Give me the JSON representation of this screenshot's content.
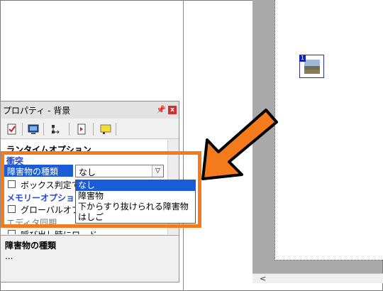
{
  "panel": {
    "title": "プロパティ - 背景",
    "pin_icon": "pin-icon",
    "close_label": "x"
  },
  "toolbar": {
    "icons": [
      "check-doc-icon",
      "screen-icon",
      "tree-arrow-icon",
      "doc-arrow-icon",
      "message-icon"
    ]
  },
  "grid": {
    "section_runtime": "ランタイムオプション",
    "sub_collision": "衝突",
    "obstacle_label": "障害物の種類",
    "box_label": "ボックス判定で",
    "section_memory": "メモリーオプション",
    "global_label": "グローバルオブ",
    "editor_sync": "エディタ同期",
    "load_label": "呼び出し時にロード"
  },
  "combo": {
    "value": "なし"
  },
  "dropdown": {
    "options": [
      "なし",
      "障害物",
      "下からすり抜けられる障害物",
      "はしご"
    ],
    "selected_index": 0
  },
  "description": {
    "title": "障害物の種類",
    "body": "..."
  },
  "colors": {
    "highlight": "#f47a1c",
    "selection": "#1a5bd8"
  }
}
